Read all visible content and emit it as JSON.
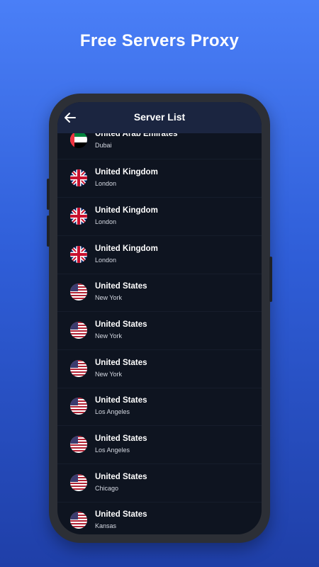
{
  "headline": "Free Servers Proxy",
  "appbar": {
    "title": "Server List",
    "back_icon": "arrow-left-icon"
  },
  "colors": {
    "background_top": "#4a7ff7",
    "background_bottom": "#1f3fa8",
    "screen": "#0e1420",
    "appbar": "#1b2540"
  },
  "servers": [
    {
      "country": "United Arab Emirates",
      "city": "Dubai",
      "flag": "uae-flag-icon"
    },
    {
      "country": "United Kingdom",
      "city": "London",
      "flag": "uk-flag-icon"
    },
    {
      "country": "United Kingdom",
      "city": "London",
      "flag": "uk-flag-icon"
    },
    {
      "country": "United Kingdom",
      "city": "London",
      "flag": "uk-flag-icon"
    },
    {
      "country": "United States",
      "city": "New York",
      "flag": "us-flag-icon"
    },
    {
      "country": "United States",
      "city": "New York",
      "flag": "us-flag-icon"
    },
    {
      "country": "United States",
      "city": "New York",
      "flag": "us-flag-icon"
    },
    {
      "country": "United States",
      "city": "Los Angeles",
      "flag": "us-flag-icon"
    },
    {
      "country": "United States",
      "city": "Los Angeles",
      "flag": "us-flag-icon"
    },
    {
      "country": "United States",
      "city": "Chicago",
      "flag": "us-flag-icon"
    },
    {
      "country": "United States",
      "city": "Kansas",
      "flag": "us-flag-icon"
    }
  ]
}
